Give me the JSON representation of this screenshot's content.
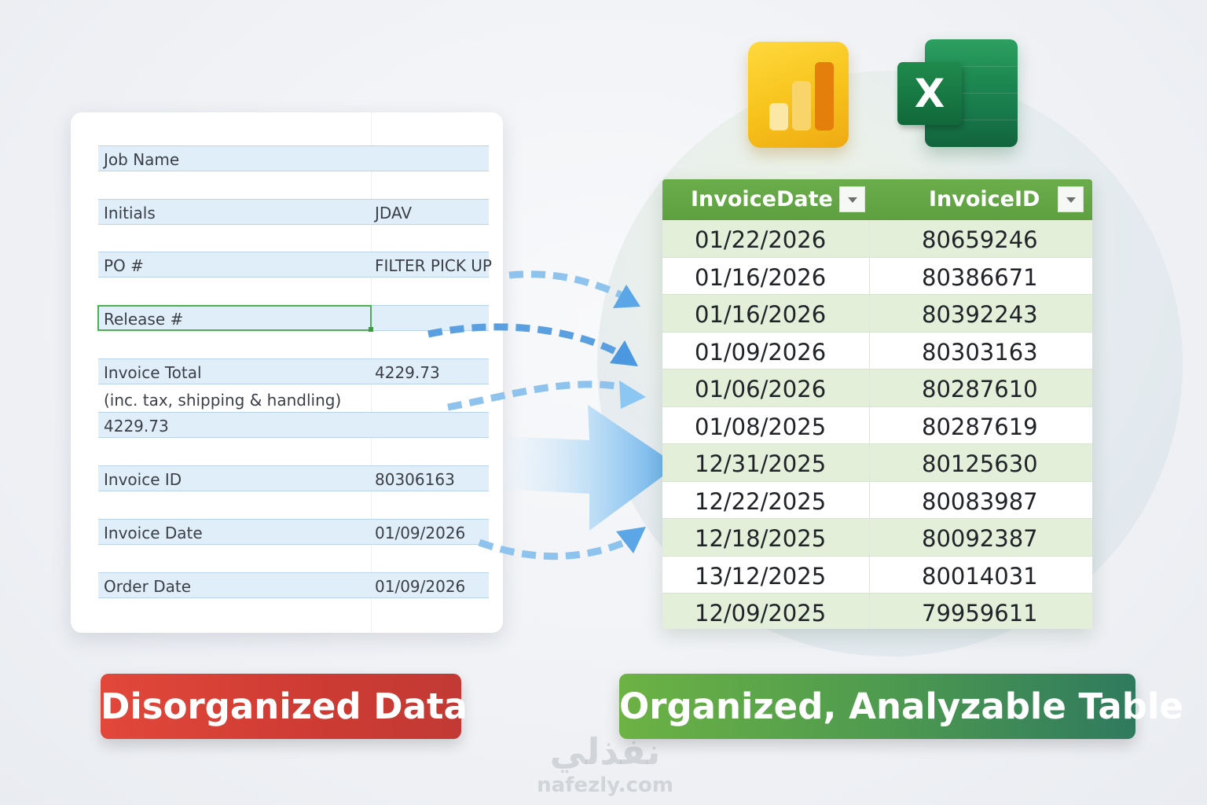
{
  "form": {
    "fields": [
      {
        "label": "Job Name",
        "value": ""
      },
      {
        "label": "Initials",
        "value": "JDAV"
      },
      {
        "label": "PO #",
        "value": "FILTER PICK UP"
      },
      {
        "label": "Release #",
        "value": ""
      },
      {
        "label": "Invoice Total",
        "value": "4229.73"
      },
      {
        "label": "Invoice ID",
        "value": "80306163"
      },
      {
        "label": "Invoice Date",
        "value": "01/09/2026"
      },
      {
        "label": "Order Date",
        "value": "01/09/2026"
      }
    ],
    "note": "(inc. tax, shipping & handling)",
    "note_value": "4229.73"
  },
  "icons": {
    "powerbi": "power-bi-icon",
    "excel": "excel-icon",
    "excel_letter": "X"
  },
  "table": {
    "headers": [
      "InvoiceDate",
      "InvoiceID"
    ],
    "rows": [
      [
        "01/22/2026",
        "80659246"
      ],
      [
        "01/16/2026",
        "80386671"
      ],
      [
        "01/16/2026",
        "80392243"
      ],
      [
        "01/09/2026",
        "80303163"
      ],
      [
        "01/06/2026",
        "80287610"
      ],
      [
        "01/08/2025",
        "80287619"
      ],
      [
        "12/31/2025",
        "80125630"
      ],
      [
        "12/22/2025",
        "80083987"
      ],
      [
        "12/18/2025",
        "80092387"
      ],
      [
        "13/12/2025",
        "80014031"
      ],
      [
        "12/09/2025",
        "79959611"
      ]
    ]
  },
  "banners": {
    "left": "Disorganized Data",
    "right": "Organized, Analyzable Table"
  },
  "watermark": {
    "arabic": "نفذلي",
    "url": "nafezly.com"
  },
  "colors": {
    "header_green": "#5e9f40",
    "row_alt": "#e4efda",
    "field_blue": "#e0eefa",
    "banner_red": "#cd3b33",
    "banner_green": "#4f9b4f",
    "arrow_blue": "#5aa6e6"
  }
}
